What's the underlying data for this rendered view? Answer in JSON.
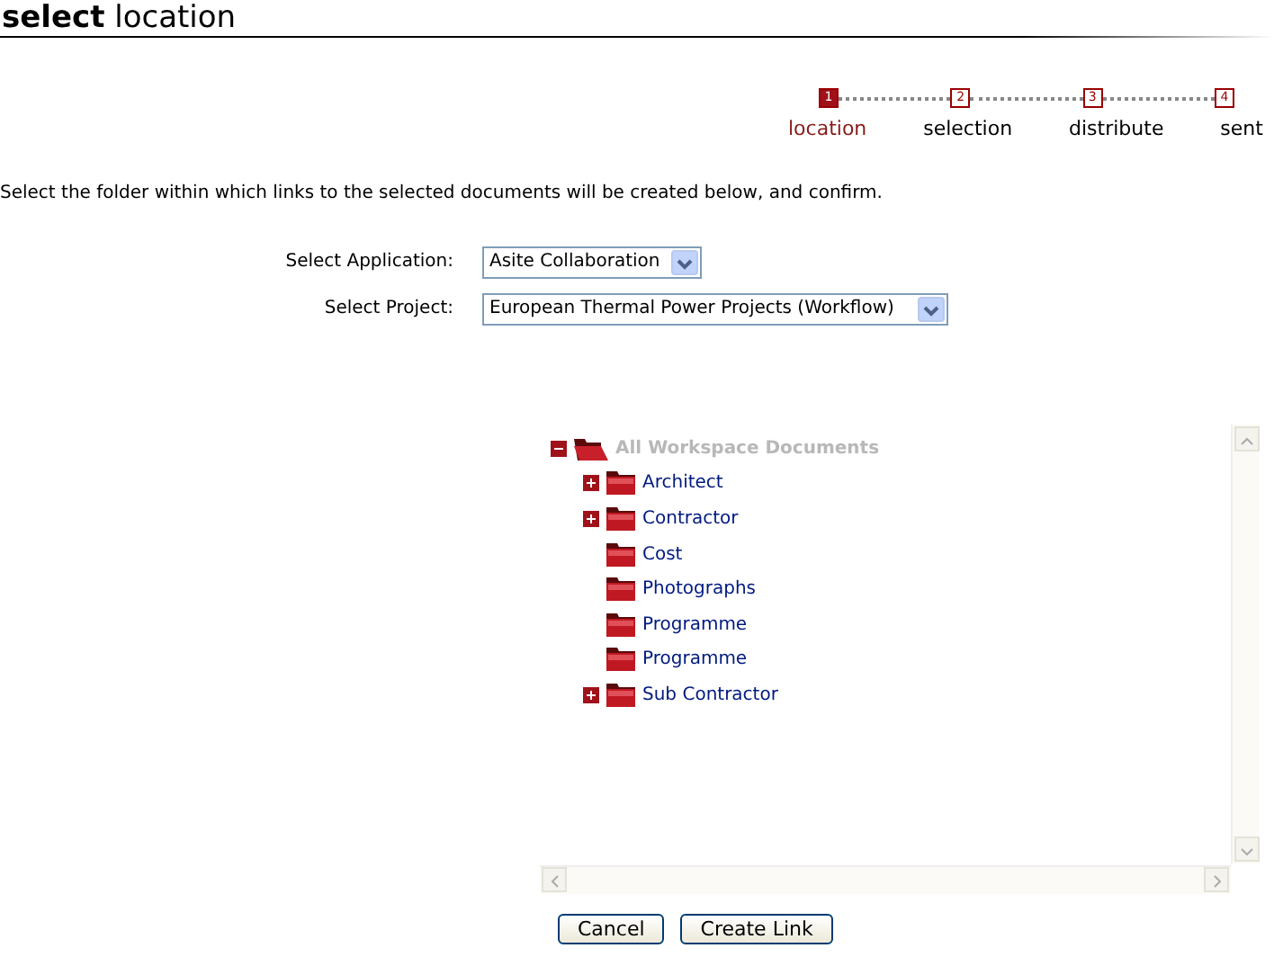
{
  "heading": "**select** location",
  "steps": [
    {
      "number": "1",
      "label": "location",
      "selected": true
    },
    {
      "number": "2",
      "label": "selection",
      "selected": false
    },
    {
      "number": "3",
      "label": "distribute",
      "selected": false
    },
    {
      "number": "4",
      "label": "sent",
      "selected": false
    }
  ],
  "instruction": "Select the folder within which links to the selected documents will be created below, and confirm.",
  "fields": [
    {
      "label": "Select Application:",
      "value": "Asite Collaboration"
    },
    {
      "label": "Select Project:",
      "value": "European Thermal Power Projects (Workflow)"
    }
  ],
  "tree": {
    "label": "All Workspace Documents",
    "expanded": true,
    "disabled": true,
    "children": [
      {
        "label": "Architect",
        "has_children": true,
        "expanded": false
      },
      {
        "label": "Contractor",
        "has_children": true,
        "expanded": false
      },
      {
        "label": "Cost",
        "has_children": false
      },
      {
        "label": "Photographs",
        "has_children": false
      },
      {
        "label": "Programme",
        "has_children": false
      },
      {
        "label": "Programme",
        "has_children": false
      },
      {
        "label": "Sub Contractor",
        "has_children": true,
        "expanded": false
      }
    ]
  },
  "buttons": [
    "Cancel",
    "Create Link"
  ]
}
